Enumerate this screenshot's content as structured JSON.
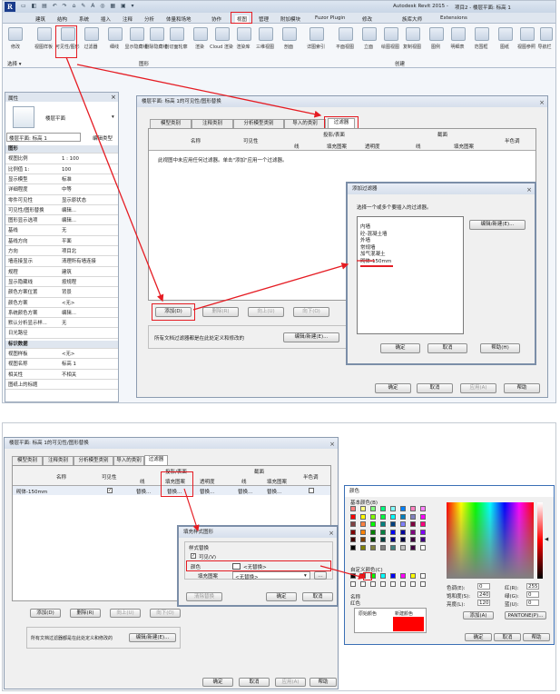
{
  "top": {
    "app_title": "Autodesk Revit 2015 -",
    "doc_title": "项目2 - 楼层平面: 标高 1",
    "ribbon_tabs": [
      "建筑",
      "结构",
      "系统",
      "插入",
      "注释",
      "分析",
      "体量和场地",
      "协作",
      "视图",
      "管理",
      "附加模块",
      "Fuzor Plugin",
      "修改",
      "族库大师",
      "Extensions"
    ],
    "ribbon_btns": [
      "修改",
      "视图样板",
      "可见性/图形",
      "过滤器",
      "细线",
      "显示隐藏线",
      "删除隐藏线",
      "剖切面轮廓",
      "渲染",
      "Cloud 渲染",
      "渲染库",
      "三维视图",
      "剖面",
      "详图索引",
      "平面视图",
      "立面",
      "绘图视图",
      "复制视图",
      "图例",
      "明细表",
      "范围框",
      "图纸",
      "视图参照",
      "导航栏"
    ],
    "panel_select": "选择 ▾",
    "panel_graphics": "图形",
    "panel_create": "创建",
    "properties": {
      "header": "属性",
      "type_name": "楼层平面",
      "selector": "楼层平面: 标高 1",
      "edit_type": "编辑类型",
      "rows": [
        {
          "k": "图形",
          "v": "",
          "group": true
        },
        {
          "k": "视图比例",
          "v": "1 : 100"
        },
        {
          "k": "比例值 1:",
          "v": "100"
        },
        {
          "k": "显示模型",
          "v": "标准"
        },
        {
          "k": "详细程度",
          "v": "中等"
        },
        {
          "k": "零件可见性",
          "v": "显示原状态"
        },
        {
          "k": "可见性/图形替换",
          "v": "编辑..."
        },
        {
          "k": "图形显示选项",
          "v": "编辑..."
        },
        {
          "k": "基线",
          "v": "无"
        },
        {
          "k": "基线方向",
          "v": "平面"
        },
        {
          "k": "方向",
          "v": "项目北"
        },
        {
          "k": "墙连接显示",
          "v": "清理所有墙连接"
        },
        {
          "k": "规程",
          "v": "建筑"
        },
        {
          "k": "显示隐藏线",
          "v": "按规程"
        },
        {
          "k": "颜色方案位置",
          "v": "背景"
        },
        {
          "k": "颜色方案",
          "v": "<无>"
        },
        {
          "k": "系统颜色方案",
          "v": "编辑..."
        },
        {
          "k": "默认分析显示样...",
          "v": "无"
        },
        {
          "k": "日光路径",
          "v": ""
        },
        {
          "k": "标识数据",
          "v": "",
          "group": true
        },
        {
          "k": "视图样板",
          "v": "<无>"
        },
        {
          "k": "视图名称",
          "v": "标高 1"
        },
        {
          "k": "相关性",
          "v": "不相关"
        },
        {
          "k": "图纸上的标题",
          "v": ""
        }
      ]
    },
    "vg_dialog": {
      "title": "楼层平面: 标高 1的可见性/图形替换",
      "tabs": [
        "模型类别",
        "注释类别",
        "分析模型类别",
        "导入的类别",
        "过滤器"
      ],
      "col_name": "名称",
      "col_vis": "可见性",
      "col_proj": "投影/表面",
      "col_cut": "截面",
      "col_half": "半色调",
      "sub_line": "线",
      "sub_fill": "填充图案",
      "sub_trans": "透明度",
      "empty_msg": "此视图中未应用任何过滤器。单击\"添加\"应用一个过滤器。",
      "btn_add": "添加(D)",
      "btn_delete": "删除(R)",
      "btn_up": "向上(U)",
      "btn_down": "向下(O)",
      "note": "所有文档过滤器都是在此处定义和修改的",
      "btn_edit_new": "编辑/新建(E)...",
      "btn_ok": "确定",
      "btn_cancel": "取消",
      "btn_apply": "应用(A)",
      "btn_help": "帮助"
    },
    "add_filter": {
      "title": "添加过滤器",
      "prompt": "选择一个或多个要插入的过滤器。",
      "items": [
        "内墙",
        "砼-混凝土墙",
        "外墙",
        "常规墙",
        "加气混凝土",
        "砌体-150mm"
      ],
      "btn_edit_new": "编辑/新建(E)...",
      "btn_ok": "确定",
      "btn_cancel": "取消",
      "btn_help": "帮助(H)"
    }
  },
  "bottom": {
    "vg_title": "楼层平面: 标高 1的可见性/图形替换",
    "tabs": [
      "模型类别",
      "注释类别",
      "分析模型类别",
      "导入的类别",
      "过滤器"
    ],
    "col_name": "名称",
    "col_vis": "可见性",
    "col_proj": "投影/表面",
    "col_cut": "截面",
    "col_half": "半色调",
    "sub_line": "线",
    "sub_fill": "填充图案",
    "sub_trans": "透明度",
    "row_name": "砌体-150mm",
    "row_replace": "替换...",
    "btn_add": "添加(D)",
    "btn_delete": "删除(R)",
    "btn_up": "向上(U)",
    "btn_down": "向下(O)",
    "note": "所有文档过滤器都是在此处定义和修改的",
    "btn_edit_new": "编辑/新建(E)...",
    "btn_ok": "确定",
    "btn_cancel": "取消",
    "btn_apply": "应用(A)",
    "btn_help": "帮助",
    "fill_dialog": {
      "title": "填充样式图形",
      "section": "样式替换",
      "visible": "可见(V)",
      "color_label": "颜色",
      "color_value": "<无替换>",
      "pattern_label": "填充图案",
      "pattern_value": "<无替换>",
      "btn_clear": "清除替换",
      "btn_ok": "确定",
      "btn_cancel": "取消"
    },
    "color_dialog": {
      "title": "颜色",
      "basic": "基本颜色(B)",
      "custom": "自定义颜色(C)",
      "name_label": "名称",
      "name_value": "红色",
      "original": "原始颜色",
      "new": "新建颜色",
      "hue_label": "色调(E):",
      "hue": "0",
      "sat_label": "饱和度(S):",
      "sat": "240",
      "lum_label": "亮度(L):",
      "lum": "120",
      "red_label": "红(R):",
      "red": "255",
      "green_label": "绿(G):",
      "green": "0",
      "blue_label": "蓝(U):",
      "blue": "0",
      "btn_add": "添加(A)",
      "btn_pantone": "PANTONE(P)...",
      "btn_ok": "确定",
      "btn_cancel": "取消",
      "btn_help": "帮助"
    }
  },
  "colors": {
    "accent_red": "#e51c23",
    "ribbon_bg": "#dfe6ef",
    "title_blue": "#34527a"
  }
}
